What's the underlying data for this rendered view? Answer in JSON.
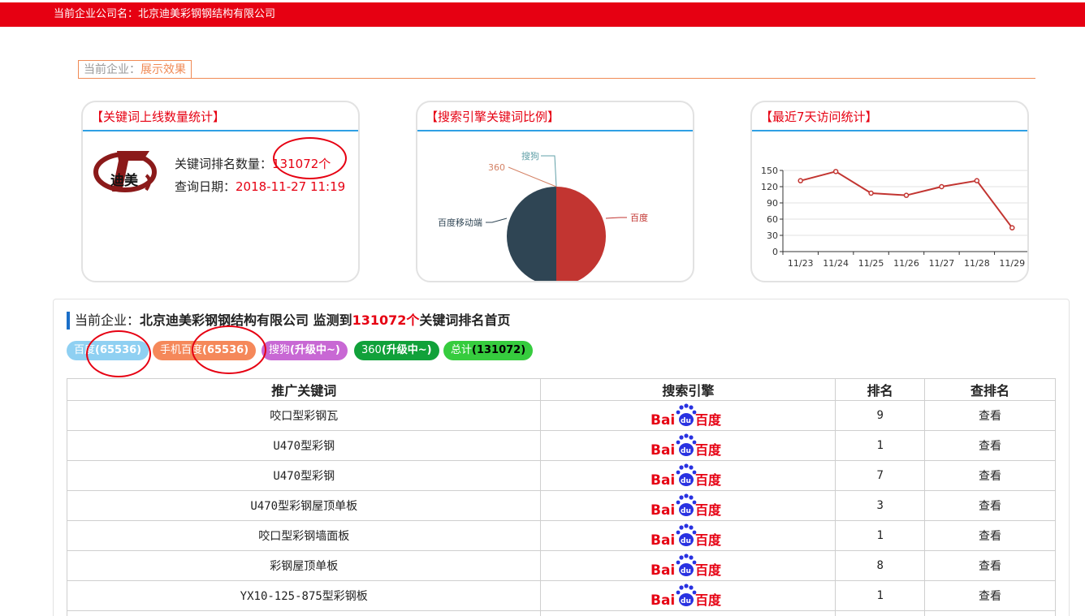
{
  "header": {
    "company_label": "当前企业公司名：北京迪美彩钢钢结构有限公司"
  },
  "section_tab": {
    "prefix": "当前企业：",
    "name": "展示效果"
  },
  "card1": {
    "title": "【关键词上线数量统计】",
    "logo_text": "迪美",
    "count_label": "关键词排名数量：",
    "count_value": "131072个",
    "date_label": "查询日期：",
    "date_value": "2018-11-27 11:19"
  },
  "card2": {
    "title": "【搜索引擎关键词比例】",
    "chart_data": {
      "type": "pie",
      "labels": [
        "百度",
        "百度移动端",
        "搜狗",
        "360"
      ],
      "values": [
        65536,
        65536,
        0,
        0
      ],
      "colors": [
        "#c23531",
        "#2f4554",
        "#61a0a8",
        "#d48265"
      ]
    }
  },
  "card3": {
    "title": "【最近7天访问统计】",
    "chart_data": {
      "type": "line",
      "x": [
        "11/23",
        "11/24",
        "11/25",
        "11/26",
        "11/27",
        "11/28",
        "11/29"
      ],
      "values": [
        131,
        148,
        108,
        104,
        120,
        131,
        44
      ],
      "yticks": [
        0,
        30,
        60,
        90,
        120,
        150
      ],
      "ylim": [
        0,
        150
      ],
      "color": "#c23531"
    }
  },
  "summary": {
    "prefix": "当前企业：",
    "company": "北京迪美彩钢钢结构有限公司",
    "mid": " 监测到",
    "count": "131072个",
    "suffix": "关键词排名首页"
  },
  "pills": [
    {
      "name": "百度",
      "value": "(65536)",
      "color": "#8fd0f2"
    },
    {
      "name": "手机百度",
      "value": "(65536)",
      "color": "#f5885a"
    },
    {
      "name": "搜狗",
      "value": "(升级中~)",
      "color": "#c868d4"
    },
    {
      "name": "360",
      "value": "(升级中~)",
      "color": "#11a13a"
    },
    {
      "name": "总计",
      "value": "(131072)",
      "color": "#36cc3e",
      "valueColor": "#000"
    }
  ],
  "table": {
    "headers": [
      "推广关键词",
      "搜索引擎",
      "排名",
      "查排名"
    ],
    "engine_logo": {
      "left": "Bai",
      "paw": "du",
      "right": "百度"
    },
    "rows": [
      {
        "keyword": "咬口型彩钢瓦",
        "rank": "9",
        "action": "查看"
      },
      {
        "keyword": "U470型彩钢",
        "rank": "1",
        "action": "查看"
      },
      {
        "keyword": "U470型彩钢",
        "rank": "7",
        "action": "查看"
      },
      {
        "keyword": "U470型彩钢屋顶单板",
        "rank": "3",
        "action": "查看"
      },
      {
        "keyword": "咬口型彩钢墙面板",
        "rank": "1",
        "action": "查看"
      },
      {
        "keyword": "彩钢屋顶单板",
        "rank": "8",
        "action": "查看"
      },
      {
        "keyword": "YX10-125-875型彩钢板",
        "rank": "1",
        "action": "查看"
      },
      {
        "keyword": "",
        "rank": "",
        "action": ""
      }
    ]
  }
}
